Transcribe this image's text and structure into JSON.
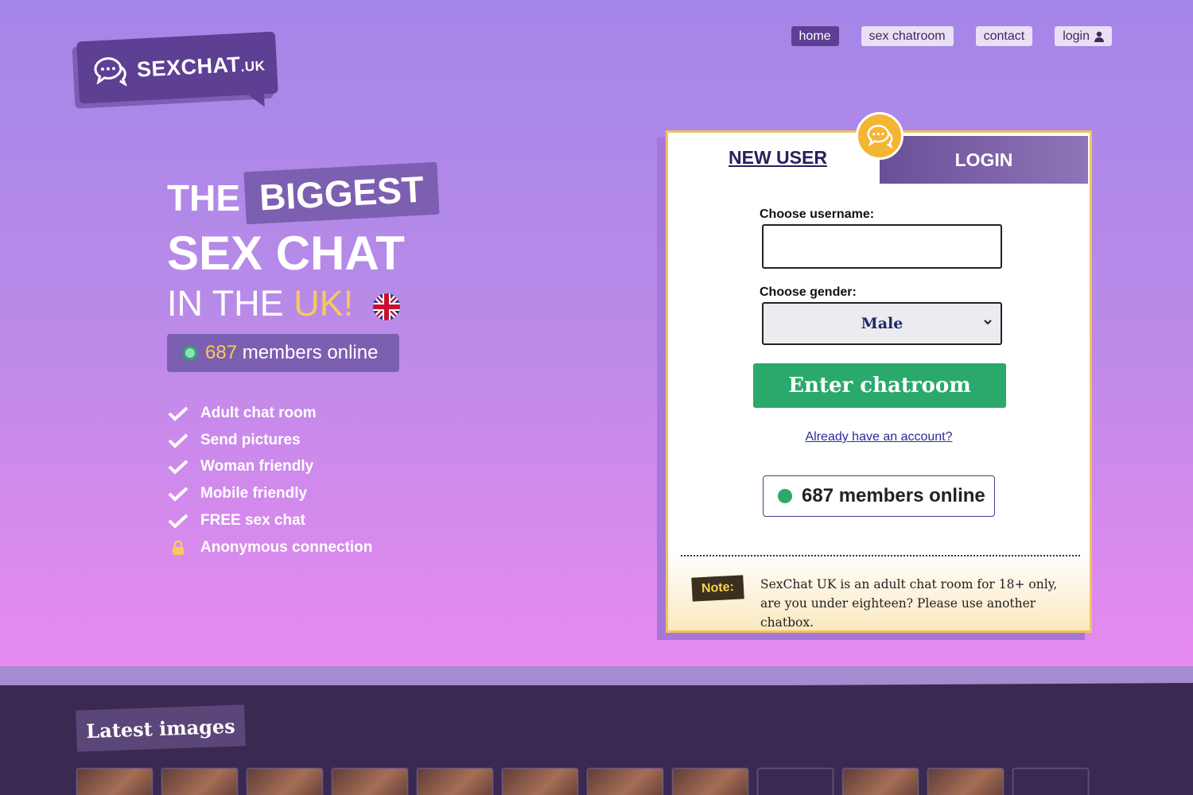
{
  "logo": {
    "name": "SEXCHAT",
    "suffix": ".UK"
  },
  "nav": {
    "home": "home",
    "sex_chatroom": "sex chatroom",
    "contact": "contact",
    "login": "login"
  },
  "hero": {
    "the": "THE",
    "biggest": "BIGGEST",
    "sex_chat": "SEX CHAT",
    "in_the": "IN THE ",
    "uk": "UK!",
    "online_count": "687",
    "online_label": " members online"
  },
  "features": [
    {
      "label": "Adult chat room",
      "icon": "check-icon"
    },
    {
      "label": "Send pictures",
      "icon": "check-icon"
    },
    {
      "label": "Woman friendly",
      "icon": "check-icon"
    },
    {
      "label": "Mobile friendly",
      "icon": "check-icon"
    },
    {
      "label": "FREE sex chat",
      "icon": "check-icon"
    },
    {
      "label": "Anonymous connection",
      "icon": "lock-icon"
    }
  ],
  "form": {
    "tab_new_user": "NEW USER",
    "tab_login": "LOGIN",
    "username_label": "Choose username:",
    "username_value": "",
    "gender_label": "Choose gender:",
    "gender_value": "Male",
    "enter_button": "Enter chatroom",
    "already_account": "Already have an account?",
    "online_text": "687 members online",
    "note_tag": "Note:",
    "note_text": "SexChat UK is an adult chat room for 18+ only, are you under eighteen? Please use another chatbox."
  },
  "latest": {
    "title": "Latest images"
  },
  "colors": {
    "primary_purple": "#5d3f93",
    "accent_yellow": "#f8c95a",
    "online_green": "#2ba86b",
    "card_border": "#f3c25c"
  }
}
